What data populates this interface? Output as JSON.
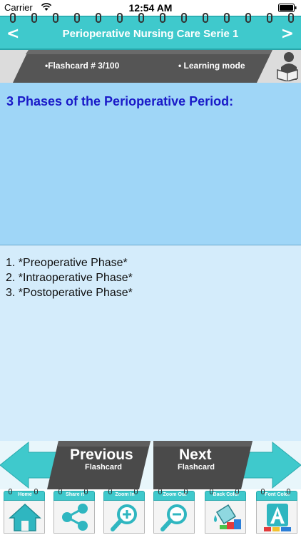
{
  "status": {
    "carrier": "Carrier",
    "time": "12:54 AM"
  },
  "header": {
    "back": "<",
    "forward": ">",
    "title": "Perioperative Nursing Care Serie 1"
  },
  "info": {
    "flashcard": "•Flashcard #  3/100",
    "mode": "• Learning mode"
  },
  "card": {
    "question": "3 Phases of the Perioperative Period:",
    "answers": [
      "1. *Preoperative Phase*",
      "2. *Intraoperative Phase*",
      "3. *Postoperative Phase*"
    ]
  },
  "nav": {
    "previous_main": "Previous",
    "previous_sub": "Flashcard",
    "next_main": "Next",
    "next_sub": "Flashcard"
  },
  "toolbar": {
    "items": [
      {
        "label": "Home",
        "icon": "home-icon"
      },
      {
        "label": "Share it",
        "icon": "share-icon"
      },
      {
        "label": "Zoom In",
        "icon": "zoom-in-icon"
      },
      {
        "label": "Zoom Out",
        "icon": "zoom-out-icon"
      },
      {
        "label": "Back Color",
        "icon": "paint-bucket-icon"
      },
      {
        "label": "Font Color",
        "icon": "font-color-icon"
      }
    ]
  },
  "colors": {
    "accent": "#3fc9cc",
    "question_bg": "#9fd6f7",
    "answer_bg": "#d4ecfb",
    "question_text": "#1a1ac8"
  }
}
